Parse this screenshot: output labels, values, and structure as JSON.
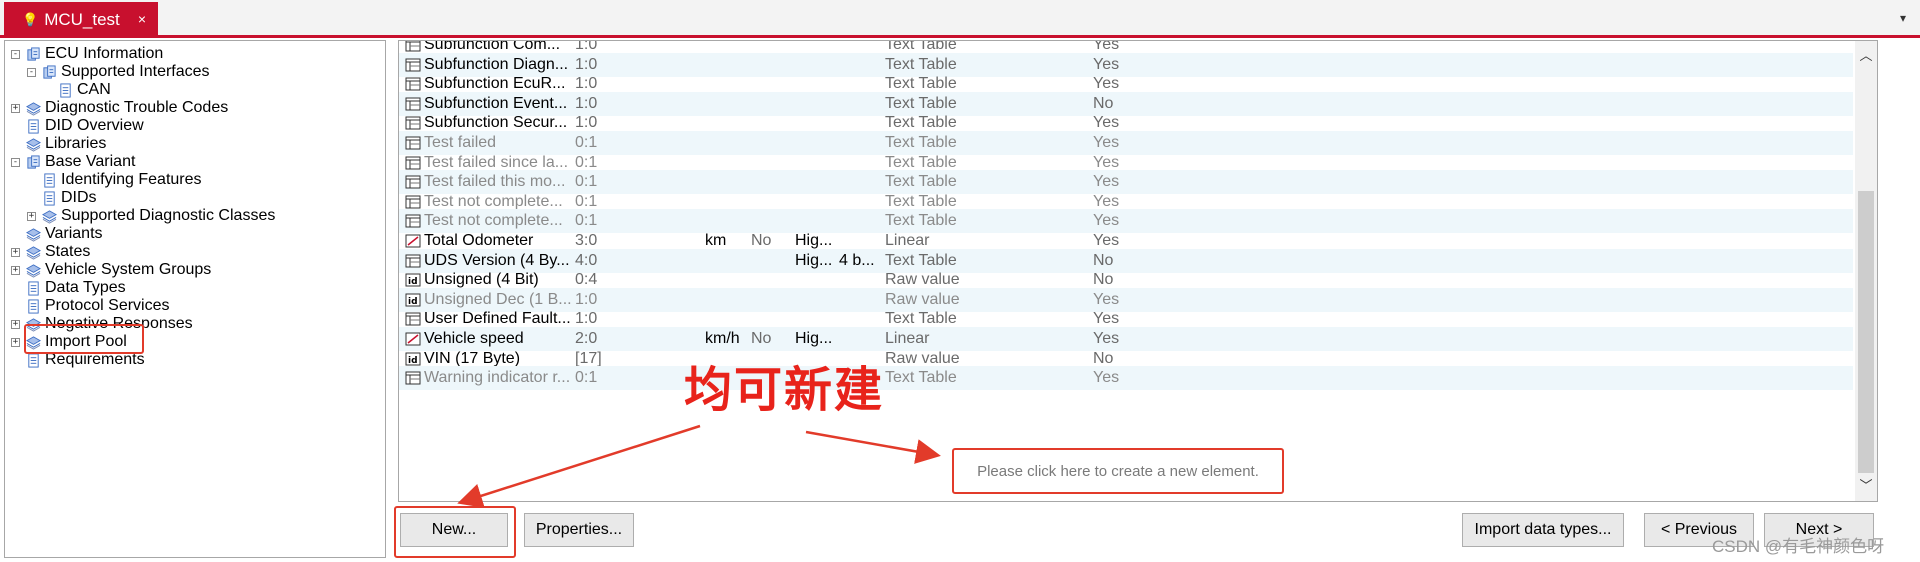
{
  "tab": {
    "title": "MCU_test",
    "close": "×",
    "menu": "▾"
  },
  "tree": [
    {
      "label": "ECU Information",
      "depth": 0,
      "expander": "−",
      "icon": "blue-folder-icon"
    },
    {
      "label": "Supported Interfaces",
      "depth": 1,
      "expander": "−",
      "icon": "blue-folder-icon"
    },
    {
      "label": "CAN",
      "depth": 2,
      "expander": "",
      "icon": "document-icon"
    },
    {
      "label": "Diagnostic Trouble Codes",
      "depth": 0,
      "expander": "+",
      "icon": "stack-icon"
    },
    {
      "label": "DID Overview",
      "depth": 0,
      "expander": "",
      "icon": "document-icon"
    },
    {
      "label": "Libraries",
      "depth": 0,
      "expander": "",
      "icon": "stack-icon"
    },
    {
      "label": "Base Variant",
      "depth": 0,
      "expander": "−",
      "icon": "blue-folder-icon"
    },
    {
      "label": "Identifying Features",
      "depth": 1,
      "expander": "",
      "icon": "document-icon"
    },
    {
      "label": "DIDs",
      "depth": 1,
      "expander": "",
      "icon": "document-icon"
    },
    {
      "label": "Supported Diagnostic Classes",
      "depth": 1,
      "expander": "+",
      "icon": "stack-icon"
    },
    {
      "label": "Variants",
      "depth": 0,
      "expander": "",
      "icon": "stack-icon"
    },
    {
      "label": "States",
      "depth": 0,
      "expander": "+",
      "icon": "stack-icon"
    },
    {
      "label": "Vehicle System Groups",
      "depth": 0,
      "expander": "+",
      "icon": "stack-icon"
    },
    {
      "label": "Data Types",
      "depth": 0,
      "expander": "",
      "icon": "document-icon"
    },
    {
      "label": "Protocol Services",
      "depth": 0,
      "expander": "",
      "icon": "document-icon"
    },
    {
      "label": "Negative Responses",
      "depth": 0,
      "expander": "+",
      "icon": "stack-icon"
    },
    {
      "label": "Import Pool",
      "depth": 0,
      "expander": "+",
      "icon": "stack-icon"
    },
    {
      "label": "Requirements",
      "depth": 0,
      "expander": "",
      "icon": "document-icon"
    }
  ],
  "rows": [
    {
      "icon": "text-table-icon",
      "name": "Subfunction Com...",
      "size": "1:0",
      "unit": "",
      "flag": "",
      "res": "",
      "res2": "",
      "conv": "Text Table",
      "used": "Yes",
      "dim": false
    },
    {
      "icon": "text-table-icon",
      "name": "Subfunction Diagn...",
      "size": "1:0",
      "unit": "",
      "flag": "",
      "res": "",
      "res2": "",
      "conv": "Text Table",
      "used": "Yes",
      "dim": false
    },
    {
      "icon": "text-table-icon",
      "name": "Subfunction EcuR...",
      "size": "1:0",
      "unit": "",
      "flag": "",
      "res": "",
      "res2": "",
      "conv": "Text Table",
      "used": "Yes",
      "dim": false
    },
    {
      "icon": "text-table-icon",
      "name": "Subfunction Event...",
      "size": "1:0",
      "unit": "",
      "flag": "",
      "res": "",
      "res2": "",
      "conv": "Text Table",
      "used": "No",
      "dim": false
    },
    {
      "icon": "text-table-icon",
      "name": "Subfunction Secur...",
      "size": "1:0",
      "unit": "",
      "flag": "",
      "res": "",
      "res2": "",
      "conv": "Text Table",
      "used": "Yes",
      "dim": false
    },
    {
      "icon": "text-table-icon",
      "name": "Test failed",
      "size": "0:1",
      "unit": "",
      "flag": "",
      "res": "",
      "res2": "",
      "conv": "Text Table",
      "used": "Yes",
      "dim": true
    },
    {
      "icon": "text-table-icon",
      "name": "Test failed since la...",
      "size": "0:1",
      "unit": "",
      "flag": "",
      "res": "",
      "res2": "",
      "conv": "Text Table",
      "used": "Yes",
      "dim": true
    },
    {
      "icon": "text-table-icon",
      "name": "Test failed this mo...",
      "size": "0:1",
      "unit": "",
      "flag": "",
      "res": "",
      "res2": "",
      "conv": "Text Table",
      "used": "Yes",
      "dim": true
    },
    {
      "icon": "text-table-icon",
      "name": "Test not complete...",
      "size": "0:1",
      "unit": "",
      "flag": "",
      "res": "",
      "res2": "",
      "conv": "Text Table",
      "used": "Yes",
      "dim": true
    },
    {
      "icon": "text-table-icon",
      "name": "Test not complete...",
      "size": "0:1",
      "unit": "",
      "flag": "",
      "res": "",
      "res2": "",
      "conv": "Text Table",
      "used": "Yes",
      "dim": true
    },
    {
      "icon": "linear-icon",
      "name": "Total Odometer",
      "size": "3:0",
      "unit": "km",
      "flag": "No",
      "res": "Hig...",
      "res2": "",
      "conv": "Linear",
      "used": "Yes",
      "dim": false
    },
    {
      "icon": "text-table-icon",
      "name": "UDS Version (4 By...",
      "size": "4:0",
      "unit": "",
      "flag": "",
      "res": "Hig...",
      "res2": "4 b...",
      "conv": "Text Table",
      "used": "No",
      "dim": false
    },
    {
      "icon": "raw-value-icon",
      "name": "Unsigned (4 Bit)",
      "size": "0:4",
      "unit": "",
      "flag": "",
      "res": "",
      "res2": "",
      "conv": "Raw value",
      "used": "No",
      "dim": false
    },
    {
      "icon": "raw-value-icon",
      "name": "Unsigned Dec (1 B...",
      "size": "1:0",
      "unit": "",
      "flag": "",
      "res": "",
      "res2": "",
      "conv": "Raw value",
      "used": "Yes",
      "dim": true
    },
    {
      "icon": "text-table-icon",
      "name": "User Defined Fault...",
      "size": "1:0",
      "unit": "",
      "flag": "",
      "res": "",
      "res2": "",
      "conv": "Text Table",
      "used": "Yes",
      "dim": false
    },
    {
      "icon": "linear-icon",
      "name": "Vehicle speed",
      "size": "2:0",
      "unit": "km/h",
      "flag": "No",
      "res": "Hig...",
      "res2": "",
      "conv": "Linear",
      "used": "Yes",
      "dim": false
    },
    {
      "icon": "raw-value-icon",
      "name": "VIN (17 Byte)",
      "size": "[17]",
      "unit": "",
      "flag": "",
      "res": "",
      "res2": "",
      "conv": "Raw value",
      "used": "No",
      "dim": false
    },
    {
      "icon": "text-table-icon",
      "name": "Warning indicator r...",
      "size": "0:1",
      "unit": "",
      "flag": "",
      "res": "",
      "res2": "",
      "conv": "Text Table",
      "used": "Yes",
      "dim": true
    }
  ],
  "new_element_hint": "Please click here to create a new element.",
  "buttons": {
    "new": "New...",
    "properties": "Properties...",
    "import": "Import data types...",
    "previous": "< Previous",
    "next": "Next >"
  },
  "annotation": "均可新建",
  "watermark": "CSDN @有毛神颜色呀",
  "colors": {
    "accent": "#c8102e",
    "annotation": "#e23b2a",
    "row_alt": "#eef7fb"
  }
}
